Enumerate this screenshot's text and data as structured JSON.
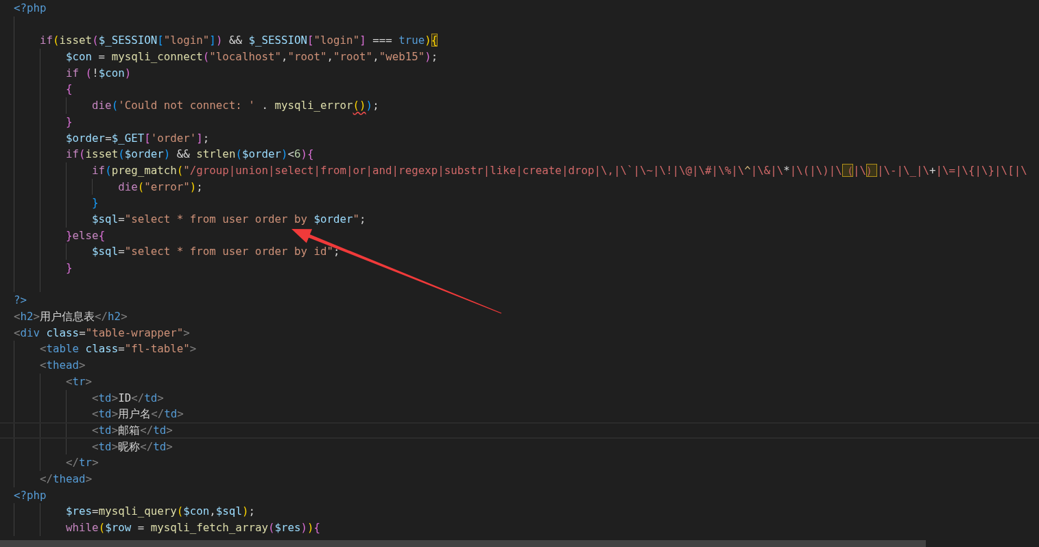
{
  "editor": {
    "lines": [
      {
        "kind": "code",
        "current": false,
        "tokens": [
          {
            "kind": "tag",
            "t": "<?php"
          }
        ]
      },
      {
        "kind": "blank",
        "current": false
      },
      {
        "kind": "code",
        "current": false,
        "tokens": [
          {
            "kind": "kw",
            "t": "    if"
          },
          {
            "kind": "b1",
            "t": "("
          },
          {
            "kind": "fn",
            "t": "isset"
          },
          {
            "kind": "b2",
            "t": "("
          },
          {
            "kind": "var",
            "t": "$_SESSION"
          },
          {
            "kind": "b3",
            "t": "["
          },
          {
            "kind": "str",
            "t": "\"login\""
          },
          {
            "kind": "b3",
            "t": "]"
          },
          {
            "kind": "b2",
            "t": ")"
          },
          {
            "kind": "plain",
            "t": " && "
          },
          {
            "kind": "var",
            "t": "$_SESSION"
          },
          {
            "kind": "b2",
            "t": "["
          },
          {
            "kind": "str",
            "t": "\"login\""
          },
          {
            "kind": "b2",
            "t": "]"
          },
          {
            "kind": "plain",
            "t": " === "
          },
          {
            "kind": "tag",
            "t": "true"
          },
          {
            "kind": "b1",
            "t": ")"
          },
          {
            "kind": "b1",
            "t": "{",
            "bracket_match": true
          }
        ]
      },
      {
        "kind": "code",
        "current": false,
        "tokens": [
          {
            "kind": "var",
            "t": "        $con"
          },
          {
            "kind": "plain",
            "t": " = "
          },
          {
            "kind": "fn",
            "t": "mysqli_connect"
          },
          {
            "kind": "b2",
            "t": "("
          },
          {
            "kind": "str",
            "t": "\"localhost\""
          },
          {
            "kind": "plain",
            "t": ","
          },
          {
            "kind": "str",
            "t": "\"root\""
          },
          {
            "kind": "plain",
            "t": ","
          },
          {
            "kind": "str",
            "t": "\"root\""
          },
          {
            "kind": "plain",
            "t": ","
          },
          {
            "kind": "str",
            "t": "\"web15\""
          },
          {
            "kind": "b2",
            "t": ")"
          },
          {
            "kind": "plain",
            "t": ";"
          }
        ]
      },
      {
        "kind": "code",
        "current": false,
        "tokens": [
          {
            "kind": "kw",
            "t": "        if"
          },
          {
            "kind": "b2",
            "t": " ("
          },
          {
            "kind": "plain",
            "t": "!"
          },
          {
            "kind": "var",
            "t": "$con"
          },
          {
            "kind": "b2",
            "t": ")"
          }
        ]
      },
      {
        "kind": "code",
        "current": false,
        "tokens": [
          {
            "kind": "b2",
            "t": "        {"
          }
        ]
      },
      {
        "kind": "code",
        "current": false,
        "tokens": [
          {
            "kind": "kw",
            "t": "            die"
          },
          {
            "kind": "b3",
            "t": "("
          },
          {
            "kind": "str",
            "t": "'Could not connect: '"
          },
          {
            "kind": "plain",
            "t": " . "
          },
          {
            "kind": "fn",
            "t": "mysqli_error"
          },
          {
            "kind": "b1",
            "t": "(",
            "error": true
          },
          {
            "kind": "b1",
            "t": ")",
            "error": true
          },
          {
            "kind": "b3",
            "t": ")"
          },
          {
            "kind": "plain",
            "t": ";"
          }
        ]
      },
      {
        "kind": "code",
        "current": false,
        "tokens": [
          {
            "kind": "b2",
            "t": "        }"
          }
        ]
      },
      {
        "kind": "code",
        "current": false,
        "tokens": [
          {
            "kind": "var",
            "t": "        $order"
          },
          {
            "kind": "plain",
            "t": "="
          },
          {
            "kind": "var",
            "t": "$_GET"
          },
          {
            "kind": "b2",
            "t": "["
          },
          {
            "kind": "str",
            "t": "'order'"
          },
          {
            "kind": "b2",
            "t": "]"
          },
          {
            "kind": "plain",
            "t": ";"
          }
        ]
      },
      {
        "kind": "code",
        "current": false,
        "tokens": [
          {
            "kind": "kw",
            "t": "        if"
          },
          {
            "kind": "b2",
            "t": "("
          },
          {
            "kind": "fn",
            "t": "isset"
          },
          {
            "kind": "b3",
            "t": "("
          },
          {
            "kind": "var",
            "t": "$order"
          },
          {
            "kind": "b3",
            "t": ")"
          },
          {
            "kind": "plain",
            "t": " && "
          },
          {
            "kind": "fn",
            "t": "strlen"
          },
          {
            "kind": "b3",
            "t": "("
          },
          {
            "kind": "var",
            "t": "$order"
          },
          {
            "kind": "b3",
            "t": ")"
          },
          {
            "kind": "plain",
            "t": "<"
          },
          {
            "kind": "num",
            "t": "6"
          },
          {
            "kind": "b2",
            "t": ")"
          },
          {
            "kind": "b2",
            "t": "{"
          }
        ]
      },
      {
        "kind": "code",
        "current": false,
        "tokens": [
          {
            "kind": "kw",
            "t": "            if"
          },
          {
            "kind": "b3",
            "t": "("
          },
          {
            "kind": "fn",
            "t": "preg_match"
          },
          {
            "kind": "b1",
            "t": "("
          },
          {
            "kind": "str",
            "t": "\""
          },
          {
            "kind": "regex",
            "t": "/group|union|select|from|or|and|regexp|substr|like|create|drop|\\,|\\`|\\~|\\!|\\@|\\#|\\%|\\"
          },
          {
            "kind": "rxsym",
            "t": "^"
          },
          {
            "kind": "regex",
            "t": "|\\&|\\"
          },
          {
            "kind": "plain",
            "t": "*"
          },
          {
            "kind": "regex",
            "t": "|\\(|\\)|\\"
          },
          {
            "kind": "regex",
            "t": "（",
            "bracket_match": true
          },
          {
            "kind": "regex",
            "t": "|\\"
          },
          {
            "kind": "regex",
            "t": "）",
            "bracket_match": true
          },
          {
            "kind": "regex",
            "t": "|\\-|\\_|\\"
          },
          {
            "kind": "plain",
            "t": "+"
          },
          {
            "kind": "regex",
            "t": "|\\=|\\{|\\}|\\[|\\"
          }
        ]
      },
      {
        "kind": "code",
        "current": false,
        "tokens": [
          {
            "kind": "kw",
            "t": "                die"
          },
          {
            "kind": "b1",
            "t": "("
          },
          {
            "kind": "str",
            "t": "\"error\""
          },
          {
            "kind": "b1",
            "t": ")"
          },
          {
            "kind": "plain",
            "t": ";"
          }
        ]
      },
      {
        "kind": "code",
        "current": false,
        "tokens": [
          {
            "kind": "b3",
            "t": "            }"
          }
        ]
      },
      {
        "kind": "code",
        "current": false,
        "tokens": [
          {
            "kind": "var",
            "t": "            $sql"
          },
          {
            "kind": "plain",
            "t": "="
          },
          {
            "kind": "str",
            "t": "\"select * from user order by "
          },
          {
            "kind": "var",
            "t": "$order"
          },
          {
            "kind": "str",
            "t": "\""
          },
          {
            "kind": "plain",
            "t": ";"
          }
        ]
      },
      {
        "kind": "code",
        "current": false,
        "tokens": [
          {
            "kind": "b2",
            "t": "        }"
          },
          {
            "kind": "kw",
            "t": "else"
          },
          {
            "kind": "b2",
            "t": "{"
          }
        ]
      },
      {
        "kind": "code",
        "current": false,
        "tokens": [
          {
            "kind": "var",
            "t": "            $sql"
          },
          {
            "kind": "plain",
            "t": "="
          },
          {
            "kind": "str",
            "t": "\"select * from user order by id\""
          },
          {
            "kind": "plain",
            "t": ";"
          }
        ]
      },
      {
        "kind": "code",
        "current": false,
        "tokens": [
          {
            "kind": "b2",
            "t": "        }"
          }
        ]
      },
      {
        "kind": "blank",
        "current": false
      },
      {
        "kind": "code",
        "current": false,
        "tokens": [
          {
            "kind": "tag",
            "t": "?>"
          }
        ]
      },
      {
        "kind": "code",
        "current": false,
        "tokens": [
          {
            "kind": "punct",
            "t": "<"
          },
          {
            "kind": "tag",
            "t": "h2"
          },
          {
            "kind": "punct",
            "t": ">"
          },
          {
            "kind": "plain",
            "t": "用户信息表"
          },
          {
            "kind": "punct",
            "t": "</"
          },
          {
            "kind": "tag",
            "t": "h2"
          },
          {
            "kind": "punct",
            "t": ">"
          }
        ]
      },
      {
        "kind": "code",
        "current": false,
        "tokens": [
          {
            "kind": "punct",
            "t": "<"
          },
          {
            "kind": "tag",
            "t": "div"
          },
          {
            "kind": "attr",
            "t": " class"
          },
          {
            "kind": "plain",
            "t": "="
          },
          {
            "kind": "str",
            "t": "\"table-wrapper\""
          },
          {
            "kind": "punct",
            "t": ">"
          }
        ]
      },
      {
        "kind": "code",
        "current": false,
        "tokens": [
          {
            "kind": "punct",
            "t": "    <"
          },
          {
            "kind": "tag",
            "t": "table"
          },
          {
            "kind": "attr",
            "t": " class"
          },
          {
            "kind": "plain",
            "t": "="
          },
          {
            "kind": "str",
            "t": "\"fl-table\""
          },
          {
            "kind": "punct",
            "t": ">"
          }
        ]
      },
      {
        "kind": "code",
        "current": false,
        "tokens": [
          {
            "kind": "punct",
            "t": "    <"
          },
          {
            "kind": "tag",
            "t": "thead"
          },
          {
            "kind": "punct",
            "t": ">"
          }
        ]
      },
      {
        "kind": "code",
        "current": false,
        "tokens": [
          {
            "kind": "punct",
            "t": "        <"
          },
          {
            "kind": "tag",
            "t": "tr"
          },
          {
            "kind": "punct",
            "t": ">"
          }
        ]
      },
      {
        "kind": "code",
        "current": false,
        "tokens": [
          {
            "kind": "punct",
            "t": "            <"
          },
          {
            "kind": "tag",
            "t": "td"
          },
          {
            "kind": "punct",
            "t": ">"
          },
          {
            "kind": "plain",
            "t": "ID"
          },
          {
            "kind": "punct",
            "t": "</"
          },
          {
            "kind": "tag",
            "t": "td"
          },
          {
            "kind": "punct",
            "t": ">"
          }
        ]
      },
      {
        "kind": "code",
        "current": false,
        "tokens": [
          {
            "kind": "punct",
            "t": "            <"
          },
          {
            "kind": "tag",
            "t": "td"
          },
          {
            "kind": "punct",
            "t": ">"
          },
          {
            "kind": "plain",
            "t": "用户名"
          },
          {
            "kind": "punct",
            "t": "</"
          },
          {
            "kind": "tag",
            "t": "td"
          },
          {
            "kind": "punct",
            "t": ">"
          }
        ]
      },
      {
        "kind": "code",
        "current": true,
        "tokens": [
          {
            "kind": "punct",
            "t": "            <"
          },
          {
            "kind": "tag",
            "t": "td"
          },
          {
            "kind": "punct",
            "t": ">"
          },
          {
            "kind": "plain",
            "t": "邮箱"
          },
          {
            "kind": "punct",
            "t": "</"
          },
          {
            "kind": "tag",
            "t": "td"
          },
          {
            "kind": "punct",
            "t": ">"
          }
        ]
      },
      {
        "kind": "code",
        "current": false,
        "tokens": [
          {
            "kind": "punct",
            "t": "            <"
          },
          {
            "kind": "tag",
            "t": "td"
          },
          {
            "kind": "punct",
            "t": ">"
          },
          {
            "kind": "plain",
            "t": "昵称"
          },
          {
            "kind": "punct",
            "t": "</"
          },
          {
            "kind": "tag",
            "t": "td"
          },
          {
            "kind": "punct",
            "t": ">"
          }
        ]
      },
      {
        "kind": "code",
        "current": false,
        "tokens": [
          {
            "kind": "punct",
            "t": "        </"
          },
          {
            "kind": "tag",
            "t": "tr"
          },
          {
            "kind": "punct",
            "t": ">"
          }
        ]
      },
      {
        "kind": "code",
        "current": false,
        "tokens": [
          {
            "kind": "punct",
            "t": "    </"
          },
          {
            "kind": "tag",
            "t": "thead"
          },
          {
            "kind": "punct",
            "t": ">"
          }
        ]
      },
      {
        "kind": "code",
        "current": false,
        "tokens": [
          {
            "kind": "tag",
            "t": "<?php"
          }
        ]
      },
      {
        "kind": "code",
        "current": false,
        "tokens": [
          {
            "kind": "var",
            "t": "        $res"
          },
          {
            "kind": "plain",
            "t": "="
          },
          {
            "kind": "fn",
            "t": "mysqli_query"
          },
          {
            "kind": "b1",
            "t": "("
          },
          {
            "kind": "var",
            "t": "$con"
          },
          {
            "kind": "plain",
            "t": ","
          },
          {
            "kind": "var",
            "t": "$sql"
          },
          {
            "kind": "b1",
            "t": ")"
          },
          {
            "kind": "plain",
            "t": ";"
          }
        ]
      },
      {
        "kind": "code",
        "current": false,
        "tokens": [
          {
            "kind": "kw",
            "t": "        while"
          },
          {
            "kind": "b1",
            "t": "("
          },
          {
            "kind": "var",
            "t": "$row"
          },
          {
            "kind": "plain",
            "t": " = "
          },
          {
            "kind": "fn",
            "t": "mysqli_fetch_array"
          },
          {
            "kind": "b2",
            "t": "("
          },
          {
            "kind": "var",
            "t": "$res"
          },
          {
            "kind": "b2",
            "t": ")"
          },
          {
            "kind": "b1",
            "t": ")"
          },
          {
            "kind": "b2",
            "t": "{"
          }
        ]
      }
    ]
  }
}
